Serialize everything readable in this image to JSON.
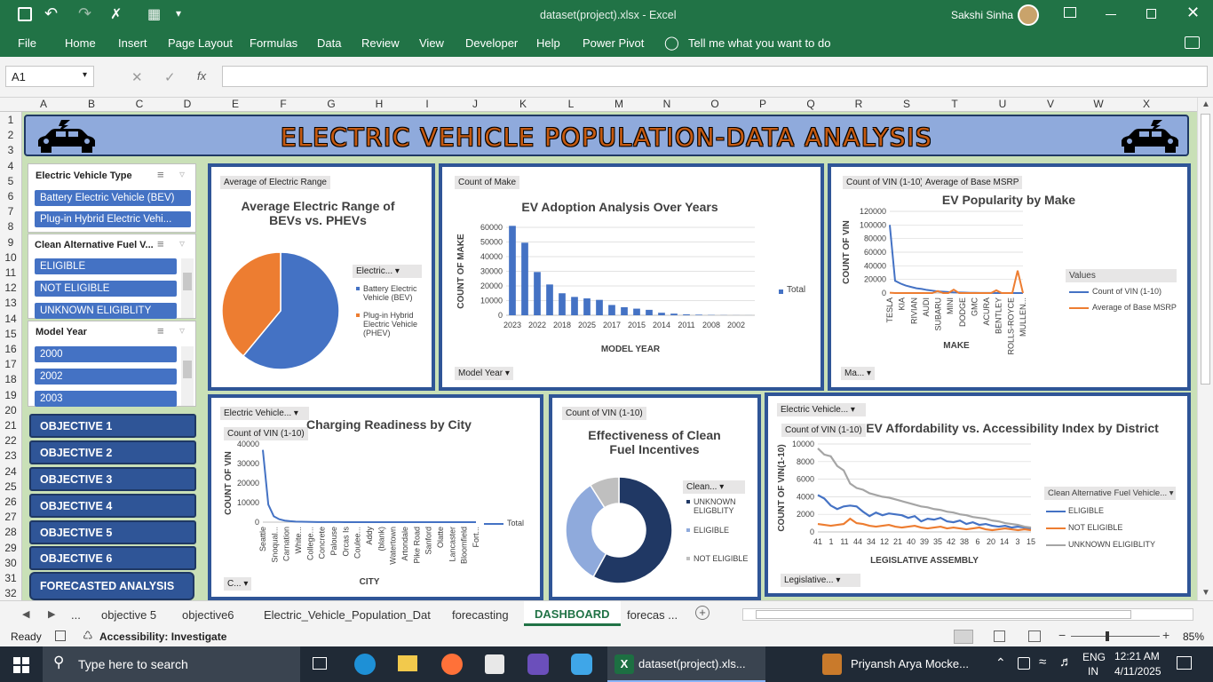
{
  "titlebar": {
    "doc_title": "dataset(project).xlsx  -  Excel",
    "user": "Sakshi Sinha"
  },
  "ribbon": {
    "tabs": [
      "File",
      "Home",
      "Insert",
      "Page Layout",
      "Formulas",
      "Data",
      "Review",
      "View",
      "Developer",
      "Help",
      "Power Pivot"
    ],
    "tell_me": "Tell me what you want to do"
  },
  "formula": {
    "name_box": "A1",
    "fx": "fx",
    "value": ""
  },
  "columns": [
    "A",
    "B",
    "C",
    "D",
    "E",
    "F",
    "G",
    "H",
    "I",
    "J",
    "K",
    "L",
    "M",
    "N",
    "O",
    "P",
    "Q",
    "R",
    "S",
    "T",
    "U",
    "V",
    "W",
    "X"
  ],
  "rows": [
    "1",
    "2",
    "3",
    "4",
    "5",
    "6",
    "7",
    "8",
    "9",
    "10",
    "11",
    "12",
    "13",
    "14",
    "15",
    "16",
    "17",
    "18",
    "19",
    "20",
    "21",
    "22",
    "23",
    "24",
    "25",
    "26",
    "27",
    "28",
    "29",
    "30",
    "31",
    "32"
  ],
  "dashboard": {
    "title": "ELECTRIC VEHICLE POPULATION-DATA ANALYSIS"
  },
  "slicers": {
    "ev_type": {
      "title": "Electric Vehicle Type",
      "items": [
        "Battery Electric Vehicle (BEV)",
        "Plug-in Hybrid Electric Vehi..."
      ]
    },
    "cafv": {
      "title": "Clean Alternative Fuel V...",
      "items": [
        "ELIGIBLE",
        "NOT ELIGIBLE",
        "UNKNOWN ELIGIBLITY"
      ]
    },
    "model_year": {
      "title": "Model Year",
      "items": [
        "2000",
        "2002",
        "2003"
      ]
    }
  },
  "objectives": [
    "OBJECTIVE 1",
    "OBJECTIVE 2",
    "OBJECTIVE 3",
    "OBJECTIVE 4",
    "OBJECTIVE 5",
    "OBJECTIVE 6"
  ],
  "forecast_button": "FORECASTED ANALYSIS",
  "panels": {
    "range": {
      "chip": "Average of Electric Range",
      "title": "Average Electric Range of BEVs vs. PHEVs",
      "filter": "Electric...",
      "legend": [
        "Battery Electric Vehicle (BEV)",
        "Plug-in Hybrid Electric Vehicle (PHEV)"
      ]
    },
    "adoption": {
      "chip": "Count of Make",
      "title": "EV Adoption Analysis Over Years",
      "filter": "Model Year",
      "legend": "Total"
    },
    "popularity": {
      "chips": [
        "Count of VIN (1-10)",
        "Average of Base MSRP"
      ],
      "title": "EV Popularity by Make",
      "filter": "Ma...",
      "legend_title": "Values",
      "legend": [
        "Count of VIN (1-10)",
        "Average of Base MSRP"
      ]
    },
    "charging": {
      "filter": "Electric Vehicle...",
      "chip": "Count of VIN (1-10)",
      "title": "Charging Readiness by City",
      "filter2": "C...",
      "legend": "Total"
    },
    "fuel": {
      "chip": "Count of VIN (1-10)",
      "title": "Effectiveness of Clean Fuel Incentives",
      "filter": "Clean...",
      "legend": [
        "UNKNOWN ELIGBLITY",
        "ELIGIBLE",
        "NOT ELIGIBLE"
      ]
    },
    "afford": {
      "filter": "Electric Vehicle...",
      "chip": "Count of VIN (1-10)",
      "title": "EV Affordability vs. Accessibility Index by District",
      "filter2": "Legislative...",
      "legend_title": "Clean Alternative Fuel Vehicle...",
      "legend": [
        "ELIGIBLE",
        "NOT ELIGIBLE",
        "UNKNOWN ELIGIBLITY"
      ]
    }
  },
  "chart_data": [
    {
      "type": "pie",
      "title": "Average Electric Range of BEVs vs. PHEVs",
      "categories": [
        "Battery Electric Vehicle (BEV)",
        "Plug-in Hybrid Electric Vehicle (PHEV)"
      ],
      "values": [
        61,
        39
      ],
      "colors": [
        "#4472c4",
        "#ed7d31"
      ]
    },
    {
      "type": "bar",
      "title": "EV Adoption Analysis Over Years",
      "xlabel": "MODEL YEAR",
      "ylabel": "COUNT OF MAKE",
      "ylim": [
        0,
        60000
      ],
      "yticks": [
        0,
        10000,
        20000,
        30000,
        40000,
        50000,
        60000
      ],
      "categories": [
        "2023",
        "2022",
        "2018",
        "2025",
        "2017",
        "2015",
        "2014",
        "2011",
        "2008",
        "2002"
      ],
      "x_labels": [
        "2023",
        "2022",
        "2018",
        "2025",
        "2017",
        "2015",
        "2014",
        "2011",
        "2008",
        "2002"
      ],
      "values": [
        61000,
        49500,
        29500,
        21000,
        15000,
        12500,
        11500,
        10500,
        7000,
        5500,
        4500,
        3700,
        1700,
        1100,
        600,
        400,
        200,
        100,
        50,
        30
      ],
      "color": "#4472c4",
      "legend": "Total"
    },
    {
      "type": "line",
      "title": "EV Popularity by Make",
      "xlabel": "MAKE",
      "ylabel": "COUNT OF VIN",
      "ylim": [
        0,
        120000
      ],
      "yticks": [
        0,
        20000,
        40000,
        60000,
        80000,
        100000,
        120000
      ],
      "x_labels": [
        "TESLA",
        "KIA",
        "RIVIAN",
        "AUDI",
        "SUBARU",
        "MINI",
        "DODGE",
        "GMC",
        "ACURA",
        "BENTLEY",
        "ROLLS-ROYCE",
        "MULLEN..."
      ],
      "series": [
        {
          "name": "Count of VIN (1-10)",
          "color": "#4472c4",
          "values": [
            100000,
            18000,
            14000,
            11000,
            9000,
            7000,
            6000,
            4500,
            3500,
            2500,
            2000,
            1500,
            1000,
            800,
            600,
            400,
            300,
            200,
            150,
            100,
            80,
            60,
            50,
            40,
            30,
            20
          ]
        },
        {
          "name": "Average of Base MSRP",
          "color": "#ed7d31",
          "values": [
            500,
            0,
            0,
            0,
            0,
            0,
            0,
            0,
            0,
            3000,
            0,
            0,
            5000,
            0,
            0,
            0,
            0,
            0,
            0,
            0,
            4000,
            0,
            0,
            0,
            33000,
            0
          ]
        }
      ]
    },
    {
      "type": "line",
      "title": "Charging Readiness by City",
      "xlabel": "CITY",
      "ylabel": "COUNT OF VIN",
      "ylim": [
        0,
        40000
      ],
      "yticks": [
        0,
        10000,
        20000,
        30000,
        40000
      ],
      "x_labels": [
        "Seattle",
        "Snoqual...",
        "Carnation",
        "White...",
        "College...",
        "Concrete",
        "Palouse",
        "Orcas Is",
        "Coulee...",
        "Addy",
        "(blank)",
        "Watertown",
        "Artondale",
        "Pike Road",
        "Sanford",
        "Olatte",
        "Lancaster",
        "Bloomfield",
        "Fort..."
      ],
      "series": [
        {
          "name": "Total",
          "color": "#4472c4",
          "values": [
            37000,
            9000,
            3000,
            1500,
            800,
            500,
            300,
            200,
            150,
            100,
            80,
            60,
            50,
            40,
            30,
            20,
            20,
            10,
            10,
            10,
            10,
            10,
            10,
            10,
            10,
            10,
            10,
            10,
            10,
            10,
            10,
            10,
            10,
            10,
            10,
            10,
            10,
            10,
            10,
            10
          ]
        }
      ]
    },
    {
      "type": "pie",
      "title": "Effectiveness of Clean Fuel Incentives",
      "categories": [
        "UNKNOWN ELIGBLITY",
        "ELIGIBLE",
        "NOT ELIGIBLE"
      ],
      "values": [
        58,
        33,
        9
      ],
      "colors": [
        "#203864",
        "#8faadc",
        "#bfbfbf"
      ],
      "donut": true
    },
    {
      "type": "line",
      "title": "EV Affordability vs. Accessibility Index by District",
      "xlabel": "LEGISLATIVE ASSEMBLY",
      "ylabel": "COUNT OF VIN(1-10)",
      "ylim": [
        0,
        10000
      ],
      "yticks": [
        0,
        2000,
        4000,
        6000,
        8000,
        10000
      ],
      "x_labels": [
        "41",
        "1",
        "11",
        "44",
        "34",
        "12",
        "21",
        "40",
        "39",
        "35",
        "42",
        "38",
        "6",
        "20",
        "14",
        "3",
        "15"
      ],
      "series": [
        {
          "name": "ELIGIBLE",
          "color": "#4472c4",
          "values": [
            4200,
            3800,
            3000,
            2600,
            2900,
            3000,
            2900,
            2300,
            1800,
            2200,
            1900,
            2100,
            2000,
            1900,
            1600,
            1800,
            1200,
            1500,
            1400,
            1600,
            1200,
            1100,
            1300,
            900,
            1100,
            800,
            900,
            700,
            600,
            700,
            500,
            600,
            500,
            400
          ]
        },
        {
          "name": "NOT ELIGIBLE",
          "color": "#ed7d31",
          "values": [
            900,
            800,
            700,
            800,
            900,
            1500,
            1000,
            900,
            700,
            600,
            700,
            800,
            600,
            500,
            600,
            700,
            500,
            400,
            500,
            600,
            400,
            500,
            400,
            300,
            400,
            500,
            300,
            200,
            300,
            400,
            300,
            200,
            300,
            200
          ]
        },
        {
          "name": "UNKNOWN ELIGIBLITY",
          "color": "#a5a5a5",
          "values": [
            9500,
            8800,
            8600,
            7500,
            7000,
            5500,
            5000,
            4800,
            4400,
            4200,
            4000,
            3900,
            3700,
            3500,
            3300,
            3100,
            2900,
            2800,
            2600,
            2500,
            2300,
            2200,
            2000,
            1900,
            1700,
            1600,
            1500,
            1300,
            1200,
            1000,
            900,
            800,
            600,
            500
          ]
        }
      ]
    }
  ],
  "sheet_tabs": [
    "objective 5",
    "objective6",
    "Electric_Vehicle_Population_Dat",
    "forecasting",
    "DASHBOARD",
    "forecas ..."
  ],
  "status": {
    "ready": "Ready",
    "accessibility": "Accessibility: Investigate",
    "zoom": "85%"
  },
  "taskbar": {
    "search": "Type here to search",
    "excel_label": "dataset(project).xls...",
    "app2": "Priyansh Arya Mocke...",
    "lang1": "ENG",
    "lang2": "IN",
    "time": "12:21 AM",
    "date": "4/11/2025"
  }
}
